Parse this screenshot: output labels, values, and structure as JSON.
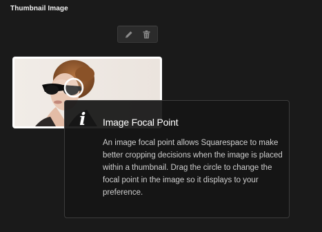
{
  "section": {
    "title": "Thumbnail Image"
  },
  "toolbar": {
    "edit_icon": "pencil-icon",
    "delete_icon": "trash-icon"
  },
  "thumbnail": {
    "alt": "Woman wearing sunglasses"
  },
  "tooltip": {
    "icon": "info-icon",
    "icon_glyph": "i",
    "title": "Image Focal Point",
    "body": "An image focal point allows Squarespace to make better cropping decisions when the image is placed within a thumbnail. Drag the circle to change the focal point in the image so it displays to your preference."
  },
  "colors": {
    "background": "#1a1a1a",
    "tooltip_background": "#161616",
    "text_primary": "#ffffff",
    "text_secondary": "#cfcfcf"
  }
}
